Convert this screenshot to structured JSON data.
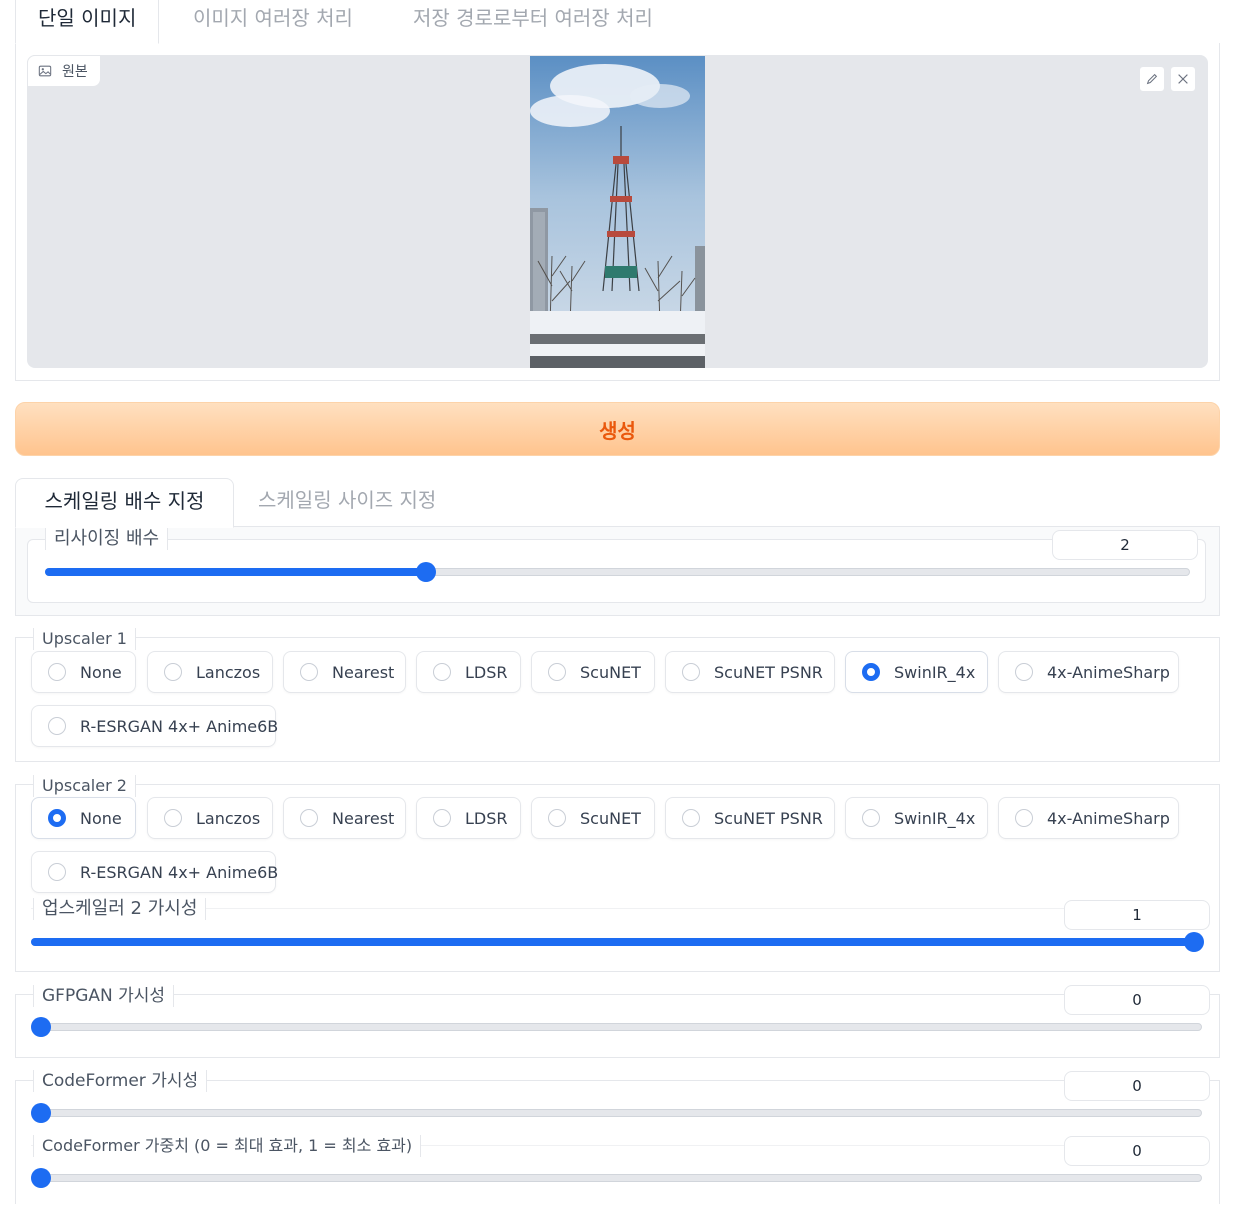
{
  "top_tabs": [
    "단일 이미지",
    "이미지 여러장 처리",
    "저장 경로로부터 여러장 처리"
  ],
  "image_label": "원본",
  "generate_label": "생성",
  "scale_tabs": [
    "스케일링 배수 지정",
    "스케일링 사이즈 지정"
  ],
  "resize": {
    "label": "리사이징 배수",
    "value": "2",
    "fill_fraction": 0.333
  },
  "upscaler1": {
    "label": "Upscaler 1",
    "options": [
      "None",
      "Lanczos",
      "Nearest",
      "LDSR",
      "ScuNET",
      "ScuNET PSNR",
      "SwinIR_4x",
      "4x-AnimeSharp",
      "R-ESRGAN 4x+ Anime6B"
    ],
    "selected": "SwinIR_4x"
  },
  "upscaler2": {
    "label": "Upscaler 2",
    "options": [
      "None",
      "Lanczos",
      "Nearest",
      "LDSR",
      "ScuNET",
      "ScuNET PSNR",
      "SwinIR_4x",
      "4x-AnimeSharp",
      "R-ESRGAN 4x+ Anime6B"
    ],
    "selected": "None"
  },
  "upscaler2_visibility": {
    "label": "업스케일러 2 가시성",
    "value": "1",
    "fill_fraction": 1.0
  },
  "gfpgan": {
    "label": "GFPGAN 가시성",
    "value": "0",
    "fill_fraction": 0.0
  },
  "codeformer_visibility": {
    "label": "CodeFormer 가시성",
    "value": "0",
    "fill_fraction": 0.0
  },
  "codeformer_weight": {
    "label": "CodeFormer 가중치 (0 = 최대 효과, 1 = 최소 효과)",
    "value": "0",
    "fill_fraction": 0.0
  },
  "colors": {
    "accent": "#1d6cf2",
    "generate_text": "#ea580c"
  },
  "icons": [
    "image-icon",
    "pencil-icon",
    "close-icon"
  ]
}
